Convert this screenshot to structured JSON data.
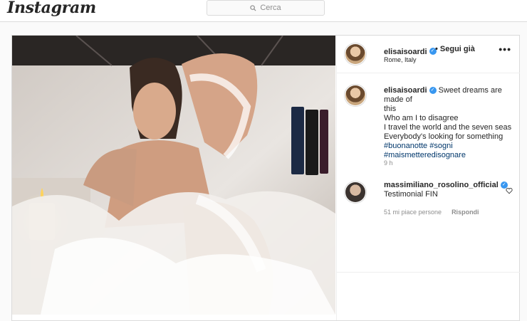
{
  "nav": {
    "logo": "Instagram",
    "search_placeholder": "Cerca"
  },
  "post": {
    "username": "elisaisoardi",
    "follow_status": "• Segui già",
    "location": "Rome, Italy",
    "more_label": "•••",
    "caption_lines": [
      "Sweet dreams are made of",
      "this",
      "Who am I to disagree",
      "I travel the world and the seven seas",
      "Everybody's looking for something"
    ],
    "hashtags": [
      "#buonanotte #sogni",
      "#maismetteredisognare"
    ],
    "time_ago": "9 h"
  },
  "comments": [
    {
      "username": "massimiliano_rosolino_official",
      "text": "Testimonial FIN",
      "likes_text": "51 mi piace persone",
      "reply_label": "Rispondi"
    }
  ],
  "colors": {
    "link": "#00376b",
    "verified": "#3897f0",
    "border": "#dbdbdb",
    "muted": "#8e8e8e"
  }
}
